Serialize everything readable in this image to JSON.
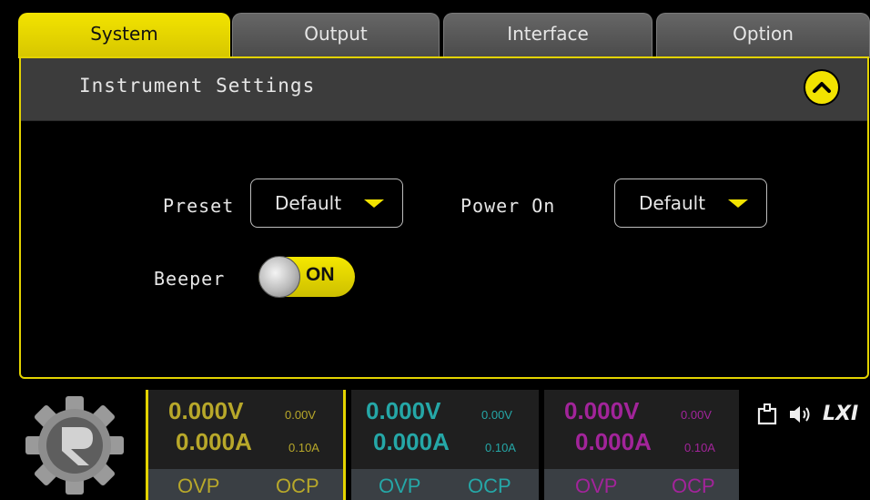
{
  "tabs": [
    {
      "label": "System",
      "active": true
    },
    {
      "label": "Output",
      "active": false
    },
    {
      "label": "Interface",
      "active": false
    },
    {
      "label": "Option",
      "active": false
    }
  ],
  "panel": {
    "title": "Instrument Settings",
    "preset": {
      "label": "Preset",
      "value": "Default"
    },
    "power_on": {
      "label": "Power On",
      "value": "Default"
    },
    "beeper": {
      "label": "Beeper",
      "state": "ON"
    }
  },
  "channels": [
    {
      "voltage": "0.000V",
      "current": "0.000A",
      "set_voltage": "0.00V",
      "set_current": "0.10A",
      "ovp": "OVP",
      "ocp": "OCP",
      "color": "#b8a82a"
    },
    {
      "voltage": "0.000V",
      "current": "0.000A",
      "set_voltage": "0.00V",
      "set_current": "0.10A",
      "ovp": "OVP",
      "ocp": "OCP",
      "color": "#25a7a7"
    },
    {
      "voltage": "0.000V",
      "current": "0.000A",
      "set_voltage": "0.00V",
      "set_current": "0.10A",
      "ovp": "OVP",
      "ocp": "OCP",
      "color": "#a2249a"
    }
  ],
  "status_icons": [
    "usb-icon",
    "speaker-icon",
    "lxi-icon"
  ],
  "status_text": {
    "lxi": "LXI"
  },
  "colors": {
    "accent": "#f2e300",
    "tab_inactive": "#555555"
  }
}
